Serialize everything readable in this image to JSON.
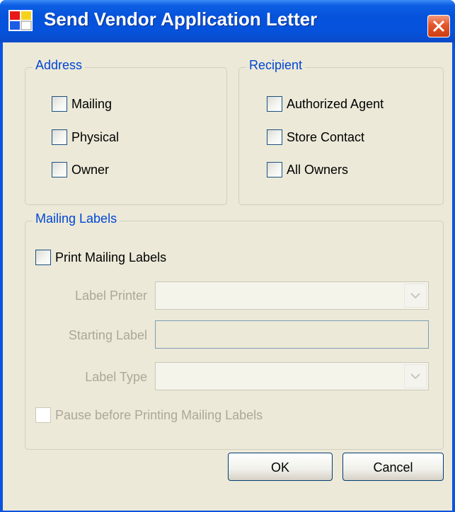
{
  "window": {
    "title": "Send Vendor Application Letter"
  },
  "address": {
    "legend": "Address",
    "options": [
      {
        "label": "Mailing",
        "checked": false
      },
      {
        "label": "Physical",
        "checked": false
      },
      {
        "label": "Owner",
        "checked": false
      }
    ]
  },
  "recipient": {
    "legend": "Recipient",
    "options": [
      {
        "label": "Authorized Agent",
        "checked": false
      },
      {
        "label": "Store Contact",
        "checked": false
      },
      {
        "label": "All Owners",
        "checked": false
      }
    ]
  },
  "mailing_labels": {
    "legend": "Mailing Labels",
    "print_label": "Print Mailing Labels",
    "print_checked": false,
    "label_printer_label": "Label Printer",
    "label_printer_value": "",
    "starting_label_label": "Starting Label",
    "starting_label_value": "",
    "label_type_label": "Label Type",
    "label_type_value": "",
    "pause_label": "Pause before Printing Mailing Labels",
    "pause_checked": false,
    "pause_enabled": false
  },
  "buttons": {
    "ok": "OK",
    "cancel": "Cancel"
  },
  "colors": {
    "title_bar": "#0553dd",
    "client_bg": "#ece9d8",
    "legend_text": "#0046d5",
    "disabled_text": "#aca899",
    "close_button": "#e3562b"
  },
  "icons": {
    "app": "app-window-icon",
    "close": "close-icon",
    "dropdown": "chevron-down-icon"
  }
}
